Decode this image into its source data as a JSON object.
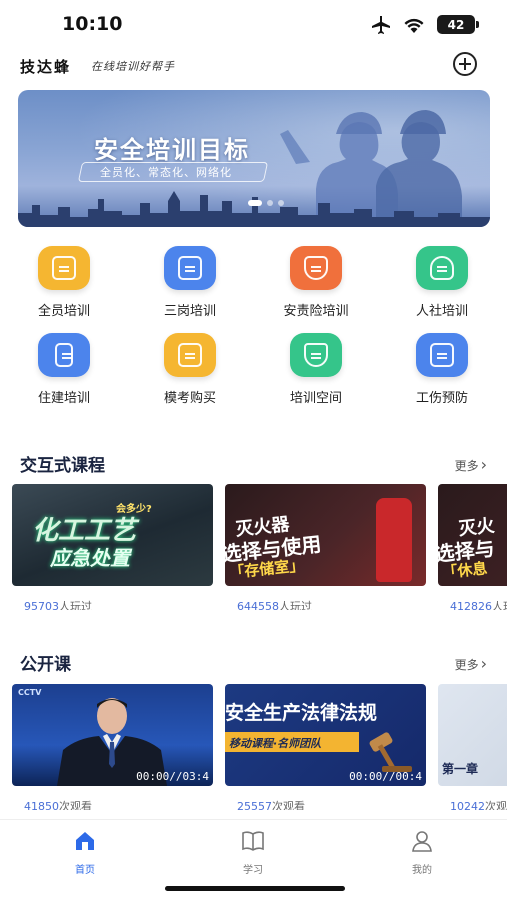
{
  "status": {
    "time": "10:10",
    "battery": "42"
  },
  "header": {
    "logo": "技达蜂",
    "slogan": "在线培训好帮手"
  },
  "banner": {
    "title": "安全培训目标",
    "subtitle": "全员化、常态化、网络化"
  },
  "grid": [
    {
      "label": "全员培训",
      "icon": "all-staff-icon",
      "color": "#f5b631"
    },
    {
      "label": "三岗培训",
      "icon": "three-post-icon",
      "color": "#4c84ec"
    },
    {
      "label": "安责险培训",
      "icon": "insurance-icon",
      "color": "#f0703c"
    },
    {
      "label": "人社培训",
      "icon": "person-icon",
      "color": "#35c58a"
    },
    {
      "label": "住建培训",
      "icon": "building-icon",
      "color": "#4c84ec"
    },
    {
      "label": "模考购买",
      "icon": "exam-bag-icon",
      "color": "#f5b631"
    },
    {
      "label": "培训空间",
      "icon": "flask-icon",
      "color": "#35c58a"
    },
    {
      "label": "工伤预防",
      "icon": "injury-prevention-icon",
      "color": "#4c84ec"
    }
  ],
  "interactive": {
    "title": "交互式课程",
    "more": "更多",
    "cards": [
      {
        "line1": "会多少?",
        "line2": "化工工艺",
        "line3": "应急处置",
        "count": "95703",
        "suffix": "人玩过"
      },
      {
        "line1": "灭火器",
        "line2": "选择与使用",
        "line3": "「存储室」",
        "count": "644558",
        "suffix": "人玩过"
      },
      {
        "line1": "灭火",
        "line2": "选择与",
        "line3": "「休息",
        "count": "412826",
        "suffix": "人玩过"
      }
    ]
  },
  "open": {
    "title": "公开课",
    "more": "更多",
    "cards": [
      {
        "line1": "CCTV",
        "line2": "",
        "duration": "00:00//03:4",
        "count": "41850",
        "suffix": "次观看"
      },
      {
        "line1": "安全生产法律法规",
        "line2": "移动课程·名师团队",
        "duration": "00:00//00:4",
        "count": "25557",
        "suffix": "次观看"
      },
      {
        "line1": "第一章",
        "line2": "",
        "duration": "",
        "count": "10242",
        "suffix": "次观看"
      }
    ]
  },
  "tabs": [
    {
      "label": "首页",
      "icon": "home-icon",
      "active": true
    },
    {
      "label": "学习",
      "icon": "book-icon",
      "active": false
    },
    {
      "label": "我的",
      "icon": "profile-icon",
      "active": false
    }
  ],
  "colors": {
    "accent": "#2d6ae8",
    "count": "#4a6fd6"
  }
}
